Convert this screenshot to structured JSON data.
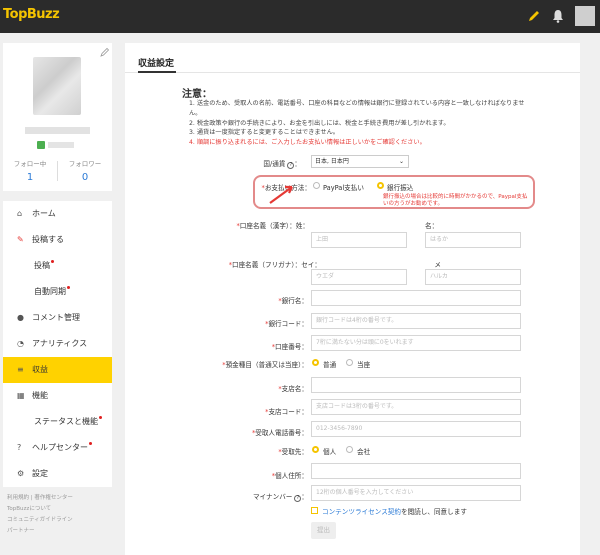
{
  "app": {
    "logo": "TopBuzz"
  },
  "header": {
    "icons": [
      "pencil-icon",
      "bell-icon"
    ],
    "accent": "#f5c400",
    "bg": "#2b2b2b"
  },
  "profile": {
    "following_label": "フォロー中",
    "following_count": "1",
    "followers_label": "フォロワー",
    "followers_count": "0"
  },
  "sidebar": {
    "items": [
      {
        "label": "ホーム",
        "icon": "home-icon"
      },
      {
        "label": "投稿する",
        "icon": "pencil-icon"
      },
      {
        "label": "投稿"
      },
      {
        "label": "自動同期"
      },
      {
        "label": "コメント管理",
        "icon": "comment-icon"
      },
      {
        "label": "アナリティクス",
        "icon": "pie-chart-icon"
      },
      {
        "label": "収益",
        "icon": "database-icon"
      },
      {
        "label": "機能",
        "icon": "grid-icon"
      },
      {
        "label": "ステータスと機能"
      },
      {
        "label": "ヘルプセンター",
        "icon": "help-icon"
      },
      {
        "label": "設定",
        "icon": "gear-icon"
      }
    ],
    "footer": [
      "利用規約",
      "著作権センター",
      "TopBuzzについて",
      "コミュニティガイドライン",
      "パートナー"
    ]
  },
  "main": {
    "title": "収益設定",
    "notice_title": "注意：",
    "notice": [
      "1. 送金のため、受取人の名前、電話番号、口座の科目などの情報は銀行に登録されている内容と一致しなければなりません。",
      "2. 税金政策や銀行の手続きにより、お金を引出しには、税金と手続き費用が差し引かれます。",
      "3. 通貨は一度指定すると変更することはできません。",
      "4. 順調に振り込まれるには、ご入力したお支払い情報は正しいかをご確認ください。"
    ],
    "currency": {
      "label": "国/通貨",
      "value": "日本, 日本円"
    },
    "payment": {
      "label": "お支払い方法：",
      "options": [
        "PayPal支払い",
        "銀行振込"
      ],
      "selected": "銀行振込",
      "note": "銀行振込の場合は比較的に時間がかかるので、Paypal支払いの方うがお勧めです。"
    },
    "name_kanji": {
      "label": "口座名義（漢字）：",
      "last_label": "姓：",
      "first_label": "名：",
      "last_placeholder": "上田",
      "first_placeholder": "はるか"
    },
    "name_kana": {
      "label": "口座名義（フリガナ）：",
      "last_label": "セイ：",
      "first_label": "メイ：",
      "last_placeholder": "ウエダ",
      "first_placeholder": "ハルカ"
    },
    "bank_name": {
      "label": "銀行名：",
      "placeholder": ""
    },
    "bank_code": {
      "label": "銀行コード：",
      "placeholder": "銀行コードは4桁の番号です。"
    },
    "account_number": {
      "label": "口座番号：",
      "placeholder": "7桁に満たない分は頭に0をいれます"
    },
    "deposit_type": {
      "label": "預金種目（普通又は当座）：",
      "options": [
        "普通",
        "当座"
      ],
      "selected": "普通"
    },
    "branch_name": {
      "label": "支店名：",
      "placeholder": ""
    },
    "branch_code": {
      "label": "支店コード：",
      "placeholder": "支店コードは3桁の番号です。"
    },
    "phone": {
      "label": "受取人電話番号：",
      "placeholder": "012-3456-7890"
    },
    "payee": {
      "label": "受取先：",
      "options": [
        "個人",
        "会社"
      ],
      "selected": "個人"
    },
    "address": {
      "label": "個人住所：",
      "placeholder": ""
    },
    "mynumber": {
      "label": "マイナンバー",
      "placeholder": "12桁の個人番号を入力してください"
    },
    "agree": {
      "link": "コンテンツライセンス契約",
      "text": "を閲読し、同意します"
    },
    "submit": "提出"
  }
}
